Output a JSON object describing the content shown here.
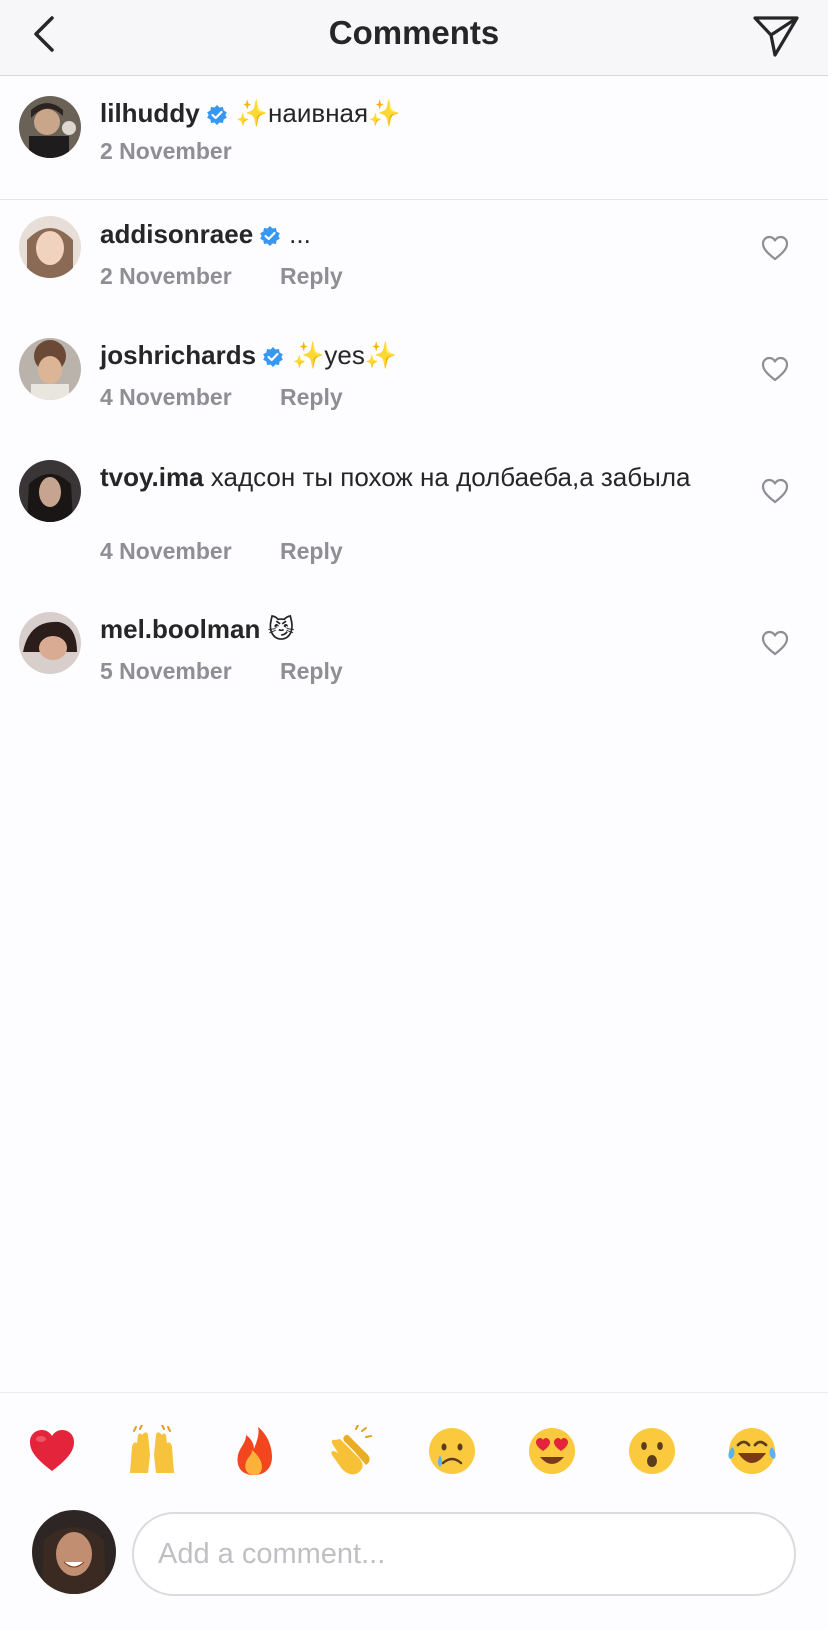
{
  "header": {
    "title": "Comments",
    "back_icon": "chevron-left-icon",
    "send_icon": "paper-plane-icon"
  },
  "caption": {
    "username": "lilhuddy",
    "verified": true,
    "text": "✨наивная✨",
    "date": "2 November"
  },
  "comments": [
    {
      "username": "addisonraee",
      "verified": true,
      "text": "...",
      "date": "2 November",
      "reply_label": "Reply"
    },
    {
      "username": "joshrichards",
      "verified": true,
      "text": "✨yes✨",
      "date": "4 November",
      "reply_label": "Reply"
    },
    {
      "username": "tvoy.ima",
      "verified": false,
      "text": "хадсон ты похож на долбаеба,а забыла",
      "date": "4 November",
      "reply_label": "Reply"
    },
    {
      "username": "mel.boolman",
      "verified": false,
      "text": "😼",
      "date": "5 November",
      "reply_label": "Reply"
    }
  ],
  "emoji_bar": {
    "emojis": [
      "❤️",
      "🙌",
      "🔥",
      "👏",
      "😢",
      "😍",
      "😮",
      "😂"
    ]
  },
  "composer": {
    "placeholder": "Add a comment..."
  },
  "colors": {
    "text": "#262626",
    "secondary": "#8e8e93",
    "verified": "#3897f0",
    "header_bg": "#f7f6f9"
  }
}
